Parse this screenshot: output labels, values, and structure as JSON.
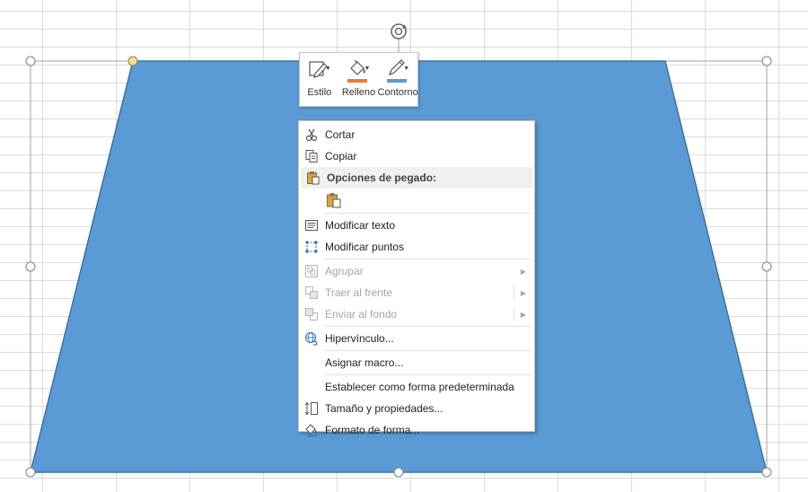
{
  "mini_toolbar": {
    "style_label": "Estilo",
    "fill_label": "Relleno",
    "outline_label": "Contorno",
    "fill_color": "#ed7d31",
    "outline_color": "#5b9bd5"
  },
  "shape": {
    "fill_color": "#5b9bd5",
    "stroke_color": "#41719c"
  },
  "context_menu": {
    "cut": "Cortar",
    "copy": "Copiar",
    "paste_options": "Opciones de pegado:",
    "edit_text": "Modificar texto",
    "edit_points": "Modificar puntos",
    "group": "Agrupar",
    "bring_to_front": "Traer al frente",
    "send_to_back": "Enviar al fondo",
    "hyperlink": "Hipervínculo...",
    "assign_macro": "Asignar macro...",
    "set_default_shape": "Establecer como forma predeterminada",
    "size_properties": "Tamaño y propiedades...",
    "format_shape": "Formato de forma..."
  }
}
